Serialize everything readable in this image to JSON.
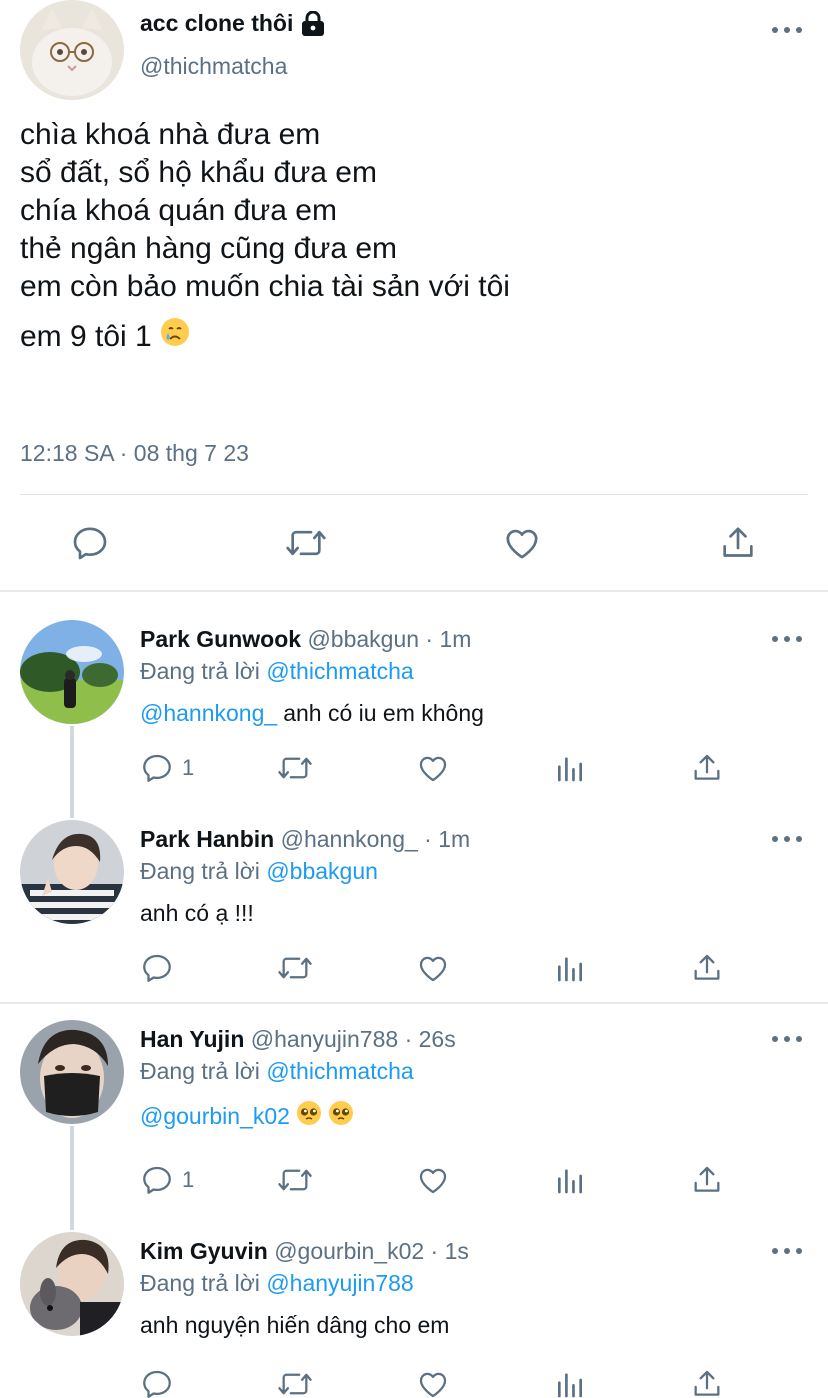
{
  "main_tweet": {
    "display_name": "acc clone thôi",
    "handle": "@thichmatcha",
    "lines": [
      "chìa khoá nhà đưa em",
      "sổ đất, sổ hộ khẩu đưa em",
      "chía khoá quán đưa em",
      "thẻ ngân hàng cũng đưa em",
      "em còn bảo muốn chia tài sản với tôi"
    ],
    "last_line": "em 9 tôi 1",
    "last_line_emoji": "crying-face-emoji",
    "timestamp": "12:18 SA · 08 thg 7 23",
    "actions": [
      "reply-icon",
      "retweet-icon",
      "like-icon",
      "share-icon"
    ]
  },
  "replies": [
    {
      "name": "Park Gunwook",
      "handle": "@bbakgun · 1m",
      "replying_prefix": "Đang trả lời",
      "replying_to": "@thichmatcha",
      "mention": "@hannkong_",
      "text": "anh có iu em không",
      "reply_count": "1"
    },
    {
      "name": "Park Hanbin",
      "handle": "@hannkong_ · 1m",
      "replying_prefix": "Đang trả lời",
      "replying_to": "@bbakgun",
      "mention": "",
      "text": "anh có ạ !!!",
      "reply_count": ""
    },
    {
      "name": "Han Yujin",
      "handle": "@hanyujin788 · 26s",
      "replying_prefix": "Đang trả lời",
      "replying_to": "@thichmatcha",
      "mention": "@gourbin_k02",
      "text": "",
      "emojis": [
        "pleading-face-emoji",
        "pleading-face-emoji"
      ],
      "reply_count": "1"
    },
    {
      "name": "Kim Gyuvin",
      "handle": "@gourbin_k02 · 1s",
      "replying_prefix": "Đang trả lời",
      "replying_to": "@hanyujin788",
      "mention": "",
      "text": "anh nguyện hiến dâng cho em",
      "reply_count": ""
    }
  ],
  "colors": {
    "text": "#0f1419",
    "secondary": "#5b7083",
    "link": "#1d9bf0",
    "divider": "#e1e5e8"
  }
}
